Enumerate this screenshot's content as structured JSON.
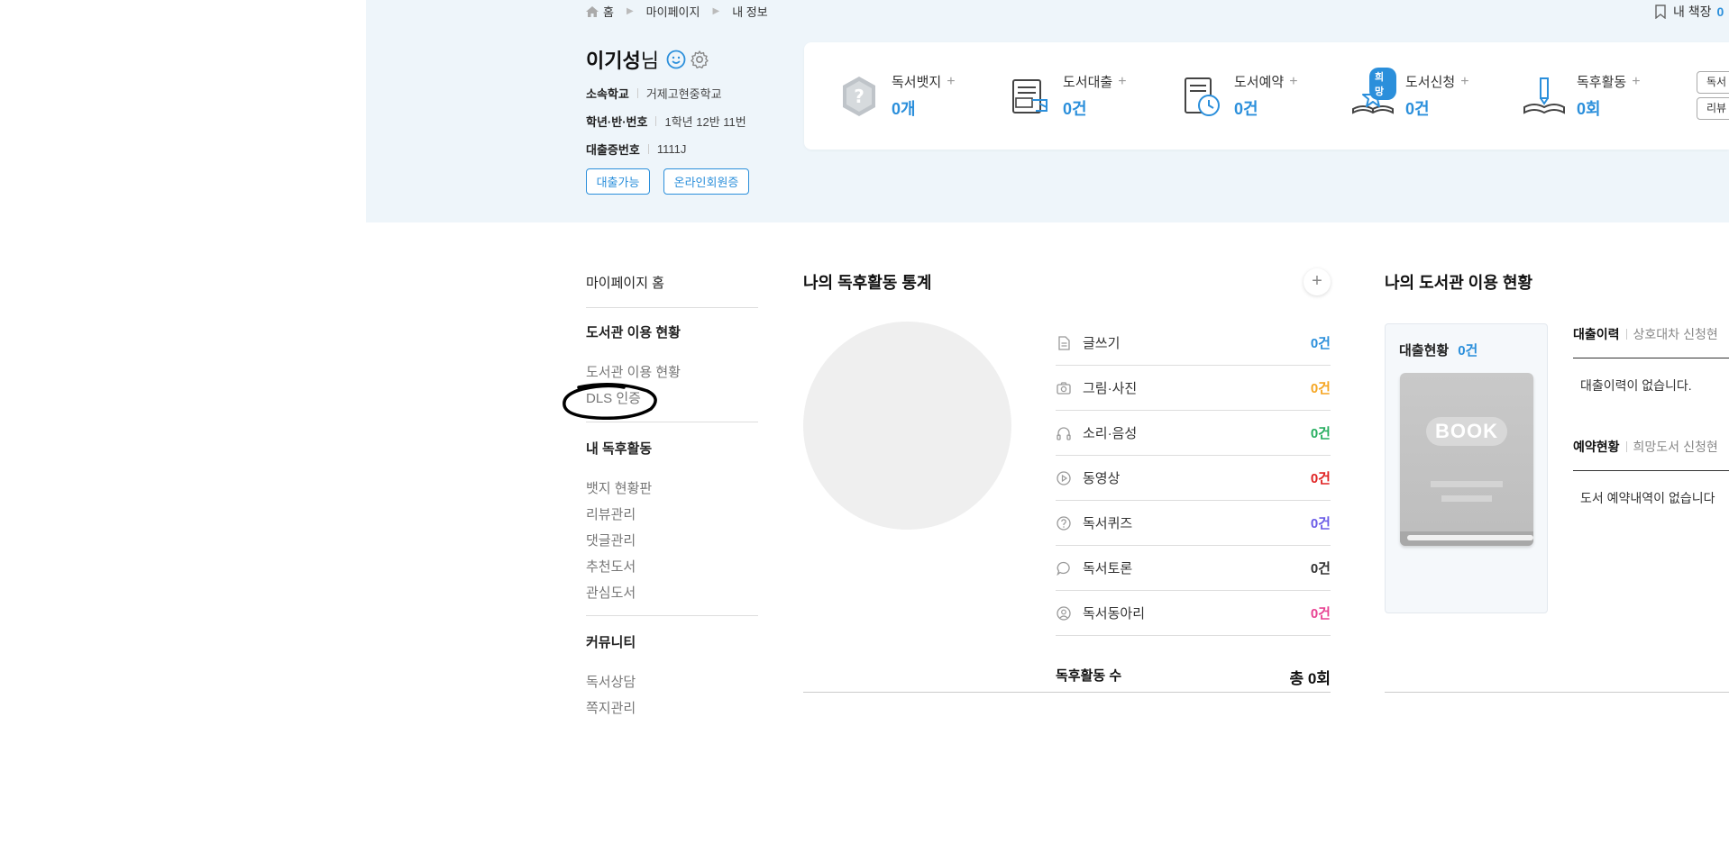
{
  "breadcrumb": {
    "home": "홈",
    "mypage": "마이페이지",
    "current": "내 정보"
  },
  "bookshelf": {
    "label": "내 책장",
    "count": "0"
  },
  "profile": {
    "name": "이기성",
    "suffix": "님",
    "school_label": "소속학교",
    "school_value": "거제고현중학교",
    "grade_label": "학년·반·번호",
    "grade_value": "1학년 12반 11번",
    "card_label": "대출증번호",
    "card_value": "1111J",
    "loan_available": "대출가능",
    "online_member": "온라인회원증"
  },
  "stats": [
    {
      "label": "독서뱃지",
      "value": "0개",
      "icon": "badge-icon"
    },
    {
      "label": "도서대출",
      "value": "0건",
      "icon": "book-loan-icon"
    },
    {
      "label": "도서예약",
      "value": "0건",
      "icon": "book-reserve-icon"
    },
    {
      "label": "도서신청",
      "value": "0건",
      "icon": "book-request-icon",
      "badge": "희망"
    },
    {
      "label": "독후활동",
      "value": "0회",
      "icon": "reading-activity-icon"
    }
  ],
  "side_buttons": [
    "독서",
    "리뷰"
  ],
  "nav": {
    "home": "마이페이지 홈",
    "library_head": "도서관 이용 현황",
    "library_sub": [
      "도서관 이용 현황",
      "DLS 인증"
    ],
    "activity_head": "내 독후활동",
    "activity_sub": [
      "뱃지 현황판",
      "리뷰관리",
      "댓글관리",
      "추천도서",
      "관심도서"
    ],
    "community_head": "커뮤니티",
    "community_sub": [
      "독서상담",
      "쪽지관리"
    ]
  },
  "activity_stats": {
    "title": "나의 독후활동 통계",
    "plus": "+",
    "rows": [
      {
        "label": "글쓰기",
        "value": "0건",
        "color": "#2b8fdb",
        "icon": "document-icon"
      },
      {
        "label": "그림·사진",
        "value": "0건",
        "color": "#f5a623",
        "icon": "camera-icon"
      },
      {
        "label": "소리·음성",
        "value": "0건",
        "color": "#27ae60",
        "icon": "headphones-icon"
      },
      {
        "label": "동영상",
        "value": "0건",
        "color": "#e02424",
        "icon": "play-icon"
      },
      {
        "label": "독서퀴즈",
        "value": "0건",
        "color": "#6b5ce7",
        "icon": "question-icon"
      },
      {
        "label": "독서토론",
        "value": "0건",
        "color": "#333333",
        "icon": "chat-icon"
      },
      {
        "label": "독서동아리",
        "value": "0건",
        "color": "#e84393",
        "icon": "user-circle-icon"
      }
    ],
    "total_label": "독후활동 수",
    "total_value": "총 0회"
  },
  "library_status": {
    "title": "나의 도서관 이용 현황",
    "loan_label": "대출현황",
    "loan_count": "0건",
    "book_placeholder": "BOOK",
    "tab1_on": "대출이력",
    "tab1_a": "상호대차",
    "tab1_b": "신청현",
    "empty1": "대출이력이 없습니다.",
    "tab2_on": "예약현황",
    "tab2_a": "희망도서",
    "tab2_b": "신청현",
    "empty2": "도서 예약내역이 없습니다"
  }
}
